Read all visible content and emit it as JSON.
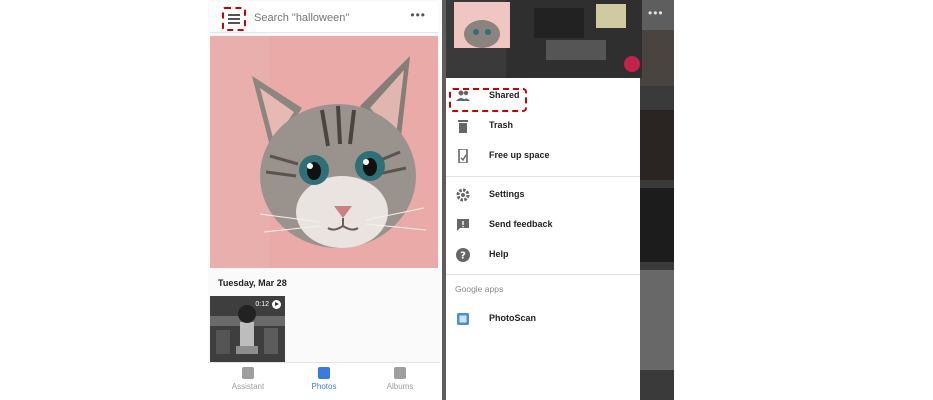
{
  "left_screen": {
    "search": {
      "placeholder": "Search \"halloween\""
    },
    "overflow_glyph": "•••",
    "section_date": "Tuesday, Mar 28",
    "video": {
      "duration": "0:12"
    },
    "bottom_nav": [
      {
        "label": "Assistant",
        "icon": "assistant-icon",
        "active": false
      },
      {
        "label": "Photos",
        "icon": "photos-icon",
        "active": true
      },
      {
        "label": "Albums",
        "icon": "albums-icon",
        "active": false
      }
    ]
  },
  "right_screen": {
    "overflow_glyph": "•••",
    "drawer": {
      "items": [
        {
          "label": "Shared",
          "icon": "people-icon",
          "highlighted": true
        },
        {
          "label": "Trash",
          "icon": "trash-icon"
        },
        {
          "label": "Free up space",
          "icon": "phone-icon"
        },
        {
          "label": "Settings",
          "icon": "gear-icon"
        },
        {
          "label": "Send feedback",
          "icon": "feedback-icon"
        },
        {
          "label": "Help",
          "icon": "help-icon"
        }
      ],
      "section_title": "Google apps",
      "apps": [
        {
          "label": "PhotoScan",
          "icon": "photoscan-icon"
        }
      ]
    }
  },
  "colors": {
    "accent_blue": "#3b7ae0",
    "highlight_red": "#cc0000",
    "cat_background_pink": "#e8a8a6"
  }
}
